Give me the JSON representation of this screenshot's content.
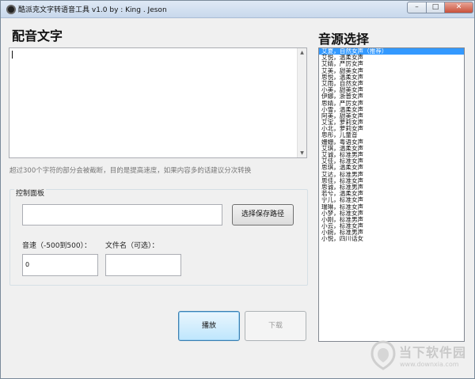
{
  "window": {
    "title": "酷派克文字转语音工具 v1.0 by : King . Jeson",
    "controls": {
      "minimize": "–",
      "maximize": "□",
      "close": "✕"
    }
  },
  "text_section": {
    "heading": "配音文字",
    "content": "",
    "hint": "超过300个字符的部分会被截断，目的是提高速度，如果内容多的话建议分次转换"
  },
  "control_panel": {
    "title": "控制面板",
    "save_path_value": "",
    "save_path_button": "选择保存路径",
    "speed_label": "音速（-500到500）：",
    "speed_value": "0",
    "filename_label": "文件名（可选）：",
    "filename_value": ""
  },
  "actions": {
    "play": "播放",
    "download": "下载"
  },
  "voice_source": {
    "heading": "音源选择",
    "selected_index": 0,
    "voices": [
      "艾夏，自然女声（推荐）",
      "艾悦，温柔女声",
      "艾婧，严厉女声",
      "艾美，甜美女声",
      "思悦，温柔女声",
      "艾雨，自然女声",
      "小美，甜美女声",
      "伊娜，浙普女声",
      "思婧，严厉女声",
      "小雪，温柔女声",
      "阿美，甜美女声",
      "艾宝，萝莉女声",
      "小北，萝莉女声",
      "思彤，儿童音",
      "姗姗，粤语女声",
      "艾琪，温柔女声",
      "艾诚，标准男声",
      "艾佳，标准女声",
      "思琪，温柔女声",
      "艾达，标准男声",
      "思佳，标准女声",
      "思诚，标准男声",
      "若兮，温柔女声",
      "宁儿，标准女声",
      "瑞琳，标准女声",
      "小梦，标准女声",
      "小刚，标准男声",
      "小云，标准女声",
      "小婉，标准男声",
      "小悦，四川话女"
    ]
  },
  "watermark": {
    "brand": "当下软件园",
    "url": "www.downxia.com"
  }
}
